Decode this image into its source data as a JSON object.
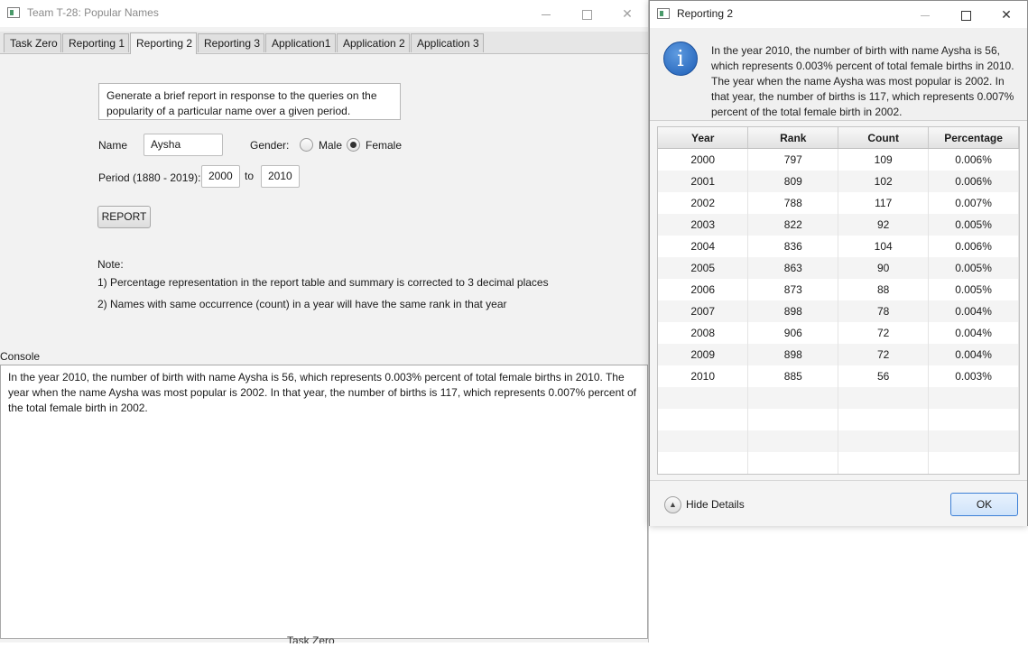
{
  "main_window": {
    "title": "Team T-28: Popular Names",
    "tabs": [
      {
        "label": "Task Zero"
      },
      {
        "label": "Reporting 1"
      },
      {
        "label": "Reporting 2",
        "active": true
      },
      {
        "label": "Reporting 3"
      },
      {
        "label": "Application1"
      },
      {
        "label": "Application 2"
      },
      {
        "label": "Application 3"
      }
    ],
    "description": "Generate a brief report in response to the queries on the popularity of a particular name over a given period.",
    "name_label": "Name",
    "name_value": "Aysha",
    "gender_label": "Gender:",
    "gender_options": [
      "Male",
      "Female"
    ],
    "gender_selected": "Female",
    "period_label": "Period (1880 - 2019):",
    "period_from": "2000",
    "period_to_label": "to",
    "period_to": "2010",
    "report_button": "REPORT",
    "note_title": "Note:",
    "note_1": "1) Percentage representation in the report table and summary is corrected to 3 decimal places",
    "note_2": "2) Names with same occurrence (count) in a year will have the same rank in that year",
    "console_label": "Console",
    "console_text": "In the year 2010, the number of birth with name Aysha is 56, which represents 0.003% percent of total female births in 2010. The year when the name Aysha was most popular is 2002. In that year, the number of births is 117, which represents 0.007% percent of the total female birth in 2002.",
    "stray_text": "Task Zero"
  },
  "dialog": {
    "title": "Reporting 2",
    "message": "In the year 2010, the number of birth with name Aysha is 56, which represents 0.003% percent of total female births in 2010. The year when the name Aysha was most popular is 2002. In that year, the number of births is 117, which represents 0.007% percent of the total female birth in 2002.",
    "columns": [
      "Year",
      "Rank",
      "Count",
      "Percentage"
    ],
    "rows": [
      [
        "2000",
        "797",
        "109",
        "0.006%"
      ],
      [
        "2001",
        "809",
        "102",
        "0.006%"
      ],
      [
        "2002",
        "788",
        "117",
        "0.007%"
      ],
      [
        "2003",
        "822",
        "92",
        "0.005%"
      ],
      [
        "2004",
        "836",
        "104",
        "0.006%"
      ],
      [
        "2005",
        "863",
        "90",
        "0.005%"
      ],
      [
        "2006",
        "873",
        "88",
        "0.005%"
      ],
      [
        "2007",
        "898",
        "78",
        "0.004%"
      ],
      [
        "2008",
        "906",
        "72",
        "0.004%"
      ],
      [
        "2009",
        "898",
        "72",
        "0.004%"
      ],
      [
        "2010",
        "885",
        "56",
        "0.003%"
      ]
    ],
    "hide_details": "Hide Details",
    "ok_button": "OK"
  }
}
